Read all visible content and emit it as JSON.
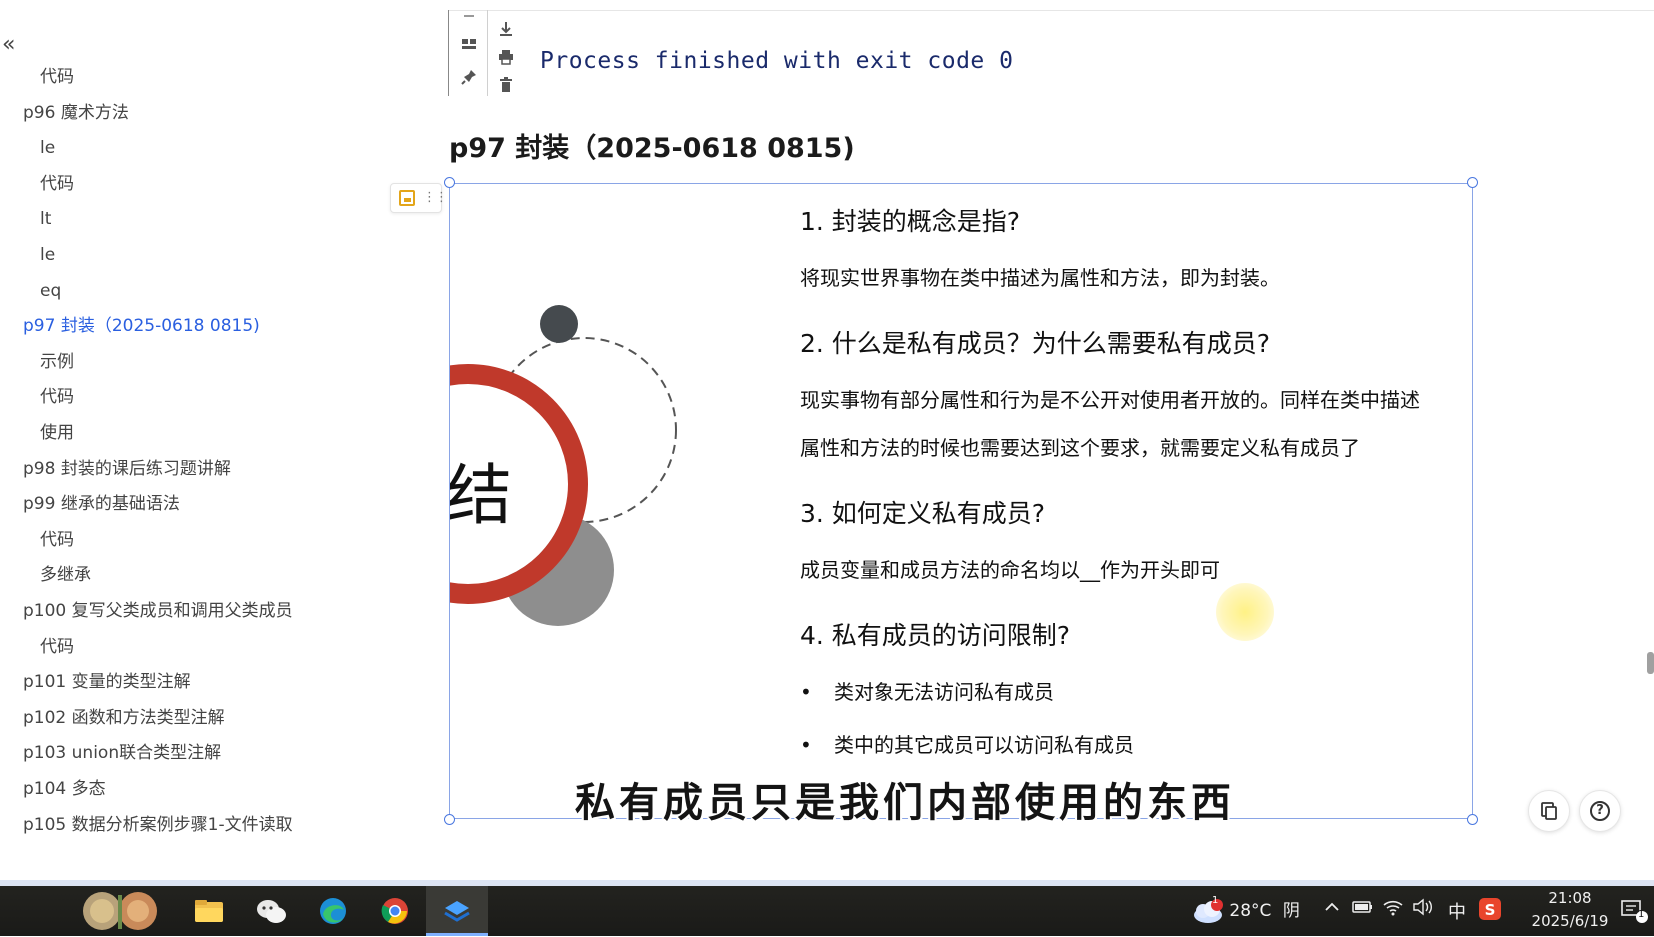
{
  "sidebar": {
    "collapse_glyph": "«",
    "items": [
      {
        "label": "代码",
        "level": 2
      },
      {
        "label": "p96 魔术方法",
        "level": 1
      },
      {
        "label": "le",
        "level": 2
      },
      {
        "label": "代码",
        "level": 2
      },
      {
        "label": "lt",
        "level": 2
      },
      {
        "label": "le",
        "level": 2
      },
      {
        "label": "eq",
        "level": 2
      },
      {
        "label": "p97 封装（2025-0618 0815)",
        "level": 1,
        "active": true
      },
      {
        "label": "示例",
        "level": 2
      },
      {
        "label": "代码",
        "level": 2
      },
      {
        "label": "使用",
        "level": 2
      },
      {
        "label": "p98 封装的课后练习题讲解",
        "level": 1
      },
      {
        "label": "p99 继承的基础语法",
        "level": 1
      },
      {
        "label": "代码",
        "level": 2
      },
      {
        "label": "多继承",
        "level": 2
      },
      {
        "label": "p100 复写父类成员和调用父类成员",
        "level": 1
      },
      {
        "label": "代码",
        "level": 2
      },
      {
        "label": "p101 变量的类型注解",
        "level": 1
      },
      {
        "label": "p102 函数和方法类型注解",
        "level": 1
      },
      {
        "label": "p103 union联合类型注解",
        "level": 1
      },
      {
        "label": "p104 多态",
        "level": 1
      },
      {
        "label": "p105 数据分析案例步骤1-文件读取",
        "level": 1
      }
    ]
  },
  "console": {
    "output": "Process finished with exit code 0"
  },
  "section": {
    "heading": "p97 封装（2025-0618 0815)"
  },
  "slide": {
    "title_fragment": "结",
    "q1": "1. 封装的概念是指?",
    "a1": "将现实世界事物在类中描述为属性和方法，即为封装。",
    "q2": "2. 什么是私有成员？为什么需要私有成员?",
    "a2_line1": "现实事物有部分属性和行为是不公开对使用者开放的。同样在类中描述",
    "a2_line2": "属性和方法的时候也需要达到这个要求，就需要定义私有成员了",
    "q3": "3. 如何定义私有成员?",
    "a3": "成员变量和成员方法的命名均以__作为开头即可",
    "q4": "4. 私有成员的访问限制?",
    "bullets": [
      "类对象无法访问私有成员",
      "类中的其它成员可以访问私有成员"
    ],
    "bullet_glyph": "•",
    "colors": {
      "ring": "#c0392b",
      "dark_dot": "#454a4e",
      "grey_disc": "#8e8e8e"
    }
  },
  "subtitle": "私有成员只是我们内部使用的东西",
  "taskbar": {
    "weather_temp": "28°C",
    "weather_desc": "阴",
    "weather_badge": "1",
    "ime": "中",
    "time": "21:08",
    "date": "2025/6/19",
    "notification_count": "1"
  }
}
